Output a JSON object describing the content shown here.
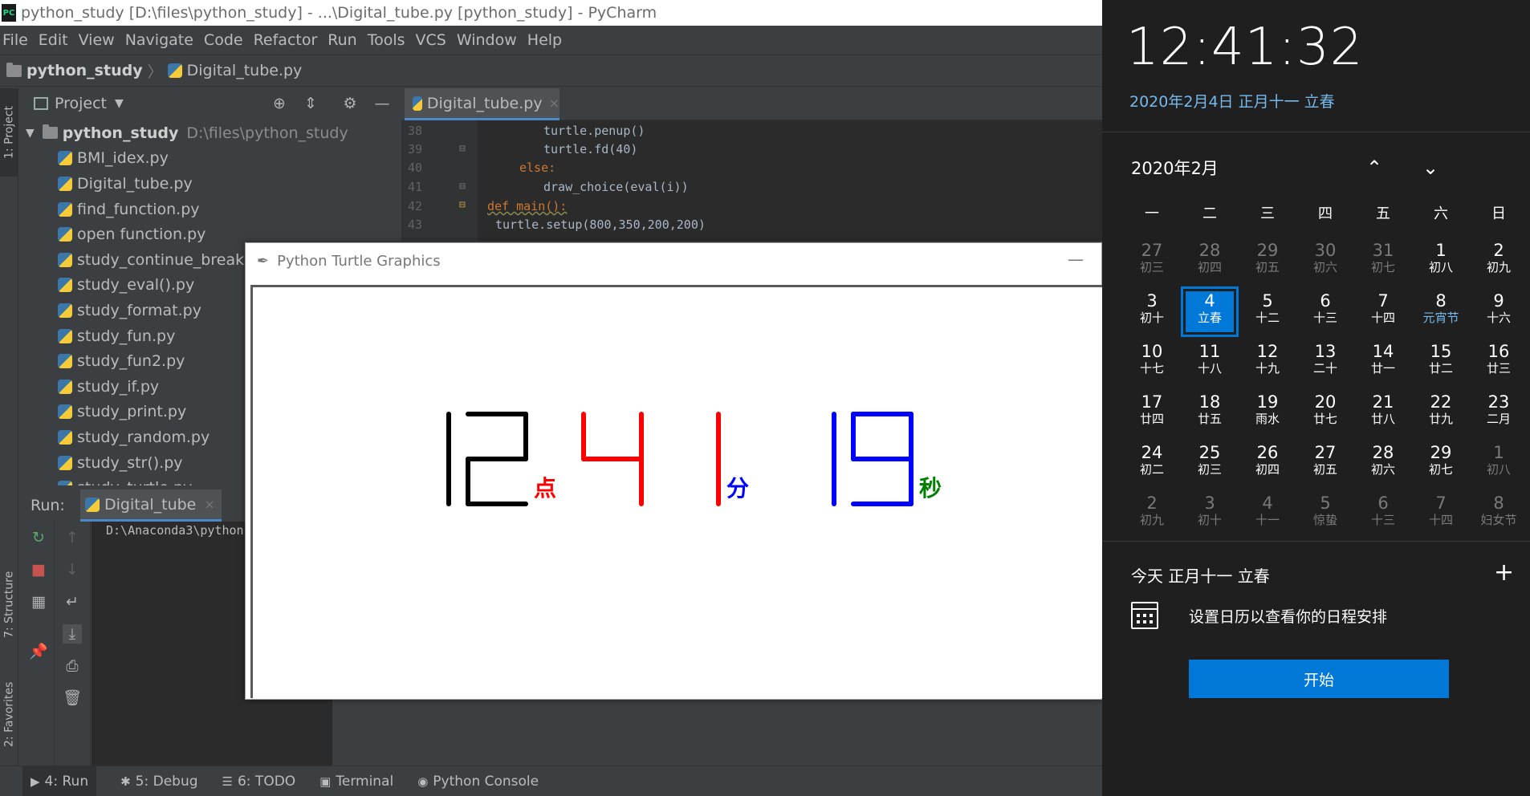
{
  "pycharm": {
    "title": "python_study [D:\\files\\python_study] - ...\\Digital_tube.py [python_study] - PyCharm",
    "menu": [
      "File",
      "Edit",
      "View",
      "Navigate",
      "Code",
      "Refactor",
      "Run",
      "Tools",
      "VCS",
      "Window",
      "Help"
    ],
    "breadcrumb": {
      "project": "python_study",
      "file": "Digital_tube.py"
    },
    "side_tabs": {
      "project": "1: Project",
      "structure": "7: Structure",
      "favorites": "2: Favorites"
    },
    "project_panel": {
      "title": "Project",
      "root": {
        "name": "python_study",
        "path": "D:\\files\\python_study"
      },
      "files": [
        "BMI_idex.py",
        "Digital_tube.py",
        "find_function.py",
        "open function.py",
        "study_continue_break.",
        "study_eval().py",
        "study_format.py",
        "study_fun.py",
        "study_fun2.py",
        "study_if.py",
        "study_print.py",
        "study_random.py",
        "study_str().py",
        "study_turtle.py"
      ]
    },
    "editor": {
      "tab": "Digital_tube.py",
      "lines": [
        {
          "n": "38",
          "text": "turtle.penup()"
        },
        {
          "n": "39",
          "text": "turtle.fd(40)"
        },
        {
          "n": "40",
          "text": "else:"
        },
        {
          "n": "41",
          "text": "draw_choice(eval(i))"
        },
        {
          "n": "42",
          "text": "def main():"
        },
        {
          "n": "43",
          "text": "turtle.setup(800,350,200,200)"
        }
      ]
    },
    "run": {
      "label": "Run:",
      "tab": "Digital_tube",
      "console": "D:\\Anaconda3\\python"
    },
    "status_tabs": [
      "4: Run",
      "5: Debug",
      "6: TODO",
      "Terminal",
      "Python Console"
    ]
  },
  "turtle": {
    "title": "Python Turtle Graphics",
    "hour": "12",
    "hour_unit": "点",
    "minute": "41",
    "minute_unit": "分",
    "second": "19",
    "second_unit": "秒",
    "colors": {
      "hour": "#000000",
      "minute": "#ff0000",
      "second": "#0000ff",
      "unit_hour": "#ff0000",
      "unit_minute": "#0000ff",
      "unit_second": "#008000"
    }
  },
  "flyout": {
    "time": "12:41:32",
    "date": "2020年2月4日 正月十一 立春",
    "month": "2020年2月",
    "weekdays": [
      "一",
      "二",
      "三",
      "四",
      "五",
      "六",
      "日"
    ],
    "days": [
      {
        "n": "27",
        "l": "初三",
        "other": true
      },
      {
        "n": "28",
        "l": "初四",
        "other": true
      },
      {
        "n": "29",
        "l": "初五",
        "other": true
      },
      {
        "n": "30",
        "l": "初六",
        "other": true
      },
      {
        "n": "31",
        "l": "初七",
        "other": true
      },
      {
        "n": "1",
        "l": "初八"
      },
      {
        "n": "2",
        "l": "初九"
      },
      {
        "n": "3",
        "l": "初十"
      },
      {
        "n": "4",
        "l": "立春",
        "today": true
      },
      {
        "n": "5",
        "l": "十二"
      },
      {
        "n": "6",
        "l": "十三"
      },
      {
        "n": "7",
        "l": "十四"
      },
      {
        "n": "8",
        "l": "元宵节",
        "fest": true
      },
      {
        "n": "9",
        "l": "十六"
      },
      {
        "n": "10",
        "l": "十七"
      },
      {
        "n": "11",
        "l": "十八"
      },
      {
        "n": "12",
        "l": "十九"
      },
      {
        "n": "13",
        "l": "二十"
      },
      {
        "n": "14",
        "l": "廿一"
      },
      {
        "n": "15",
        "l": "廿二"
      },
      {
        "n": "16",
        "l": "廿三"
      },
      {
        "n": "17",
        "l": "廿四"
      },
      {
        "n": "18",
        "l": "廿五"
      },
      {
        "n": "19",
        "l": "雨水"
      },
      {
        "n": "20",
        "l": "廿七"
      },
      {
        "n": "21",
        "l": "廿八"
      },
      {
        "n": "22",
        "l": "廿九"
      },
      {
        "n": "23",
        "l": "二月"
      },
      {
        "n": "24",
        "l": "初二"
      },
      {
        "n": "25",
        "l": "初三"
      },
      {
        "n": "26",
        "l": "初四"
      },
      {
        "n": "27",
        "l": "初五"
      },
      {
        "n": "28",
        "l": "初六"
      },
      {
        "n": "29",
        "l": "初七"
      },
      {
        "n": "1",
        "l": "初八",
        "other": true
      },
      {
        "n": "2",
        "l": "初九",
        "other": true
      },
      {
        "n": "3",
        "l": "初十",
        "other": true
      },
      {
        "n": "4",
        "l": "十一",
        "other": true
      },
      {
        "n": "5",
        "l": "惊蛰",
        "other": true
      },
      {
        "n": "6",
        "l": "十三",
        "other": true
      },
      {
        "n": "7",
        "l": "十四",
        "other": true
      },
      {
        "n": "8",
        "l": "妇女节",
        "other": true
      }
    ],
    "agenda_title": "今天 正月十一 立春",
    "agenda_message": "设置日历以查看你的日程安排",
    "start_button": "开始",
    "accent": "#0078d7"
  }
}
